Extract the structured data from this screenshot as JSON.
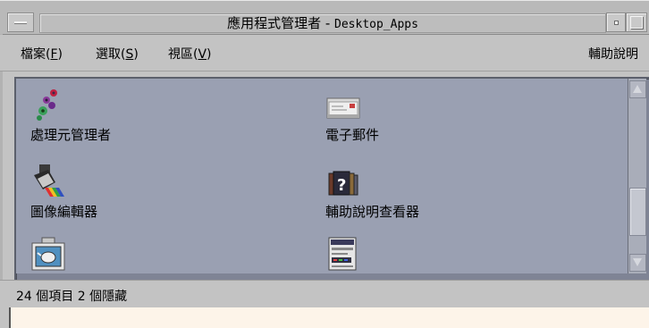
{
  "window": {
    "title_prefix": "應用程式管理者 - ",
    "title_name": "Desktop_Apps"
  },
  "menu": {
    "file": "檔案(",
    "file_key": "F",
    "file_end": ")",
    "select": "選取(",
    "select_key": "S",
    "select_end": ")",
    "view": "視區(",
    "view_key": "V",
    "view_end": ")",
    "help": "輔助說明"
  },
  "icons": [
    {
      "label": "處理元管理者",
      "icon": "process-manager-icon"
    },
    {
      "label": "電子郵件",
      "icon": "mail-icon"
    },
    {
      "label": "圖像編輯器",
      "icon": "image-editor-icon"
    },
    {
      "label": "輔助說明查看器",
      "icon": "help-viewer-icon"
    },
    {
      "label": "",
      "icon": "teapot-icon"
    },
    {
      "label": "",
      "icon": "terminal-icon"
    }
  ],
  "status": {
    "text": "24 個項目 2 個隱藏"
  },
  "colors": {
    "icon_area": "#9aa0b2",
    "footer": "#fdf4e9"
  }
}
